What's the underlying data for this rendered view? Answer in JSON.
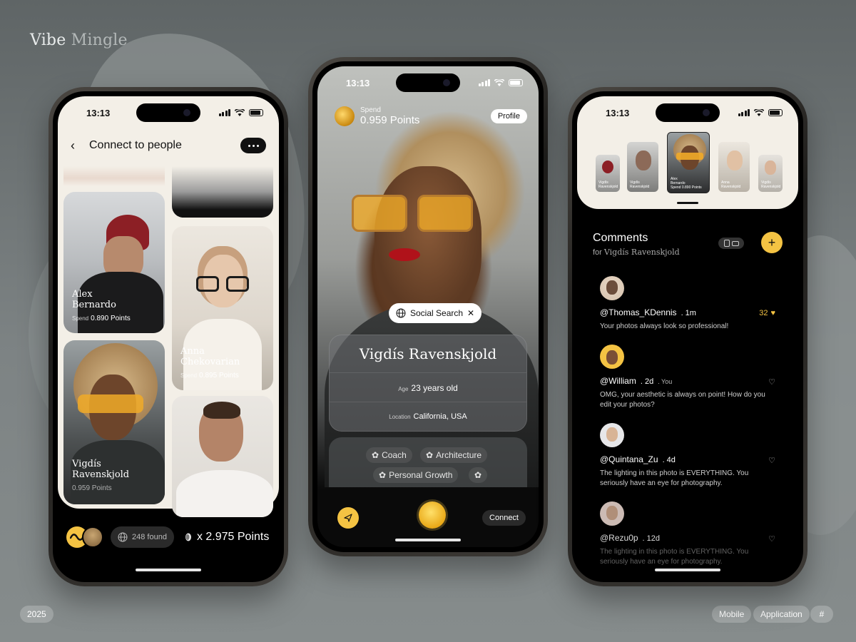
{
  "brand": {
    "word1": "Vibe",
    "word2": "Mingle"
  },
  "footer": {
    "year": "2025",
    "tags": [
      "Mobile",
      "Application",
      "#"
    ]
  },
  "status_time": "13:13",
  "phone1": {
    "title": "Connect to people",
    "cards": [
      {
        "name_line1": "Alex",
        "name_line2": "Bernardo",
        "spend_label": "Spend",
        "spend_value": "0.890 Points"
      },
      {
        "name_line1": "Anna",
        "name_line2": "Chekovarian",
        "spend_label": "Spend",
        "spend_value": "0.895 Points"
      },
      {
        "name_line1": "Vigdís",
        "name_line2": "Ravenskjold",
        "spend_label": "",
        "spend_value": "0.959 Points"
      }
    ],
    "found": "248 found",
    "total_points": "x 2.975 Points"
  },
  "phone2": {
    "spend_label": "Spend",
    "spend_value": "0.959 Points",
    "profile_button": "Profile",
    "social_search": "Social Search",
    "name": "Vigdís Ravenskjold",
    "age_label": "Age",
    "age_value": "23 years old",
    "location_label": "Location",
    "location_value": "California, USA",
    "tags": [
      "Coach",
      "Architecture",
      "Personal Growth"
    ],
    "connect_button": "Connect"
  },
  "phone3": {
    "thumbs": [
      {
        "line1": "Vigdís",
        "line2": "Ravenskjold"
      },
      {
        "line1": "Vigdís",
        "line2": "Ravenskjold"
      },
      {
        "line1": "Alex",
        "line2": "Bernardo",
        "line3": "Spend 0.890 Points"
      },
      {
        "line1": "Anna",
        "line2": "Ravenskjold"
      },
      {
        "line1": "Vigdís",
        "line2": "Ravenskjold"
      }
    ],
    "comments_title": "Comments",
    "for_label": "for",
    "for_name": "Vigdís Ravenskjold",
    "comments": [
      {
        "user": "@Thomas_KDennis",
        "time": ". 1m",
        "you": "",
        "likes": "32",
        "text": "Your photos always look so professional!"
      },
      {
        "user": "@William",
        "time": ". 2d",
        "you": ". You",
        "likes": "",
        "text": "OMG, your aesthetic is always on point! How do you edit your photos?"
      },
      {
        "user": "@Quintana_Zu",
        "time": ". 4d",
        "you": "",
        "likes": "",
        "text": "The lighting in this photo is EVERYTHING. You seriously have an eye for photography."
      },
      {
        "user": "@Rezu0p",
        "time": ". 12d",
        "you": "",
        "likes": "",
        "text": "The lighting in this photo is EVERYTHING. You seriously have an eye for photography."
      }
    ]
  },
  "colors": {
    "accent": "#f4c343",
    "cream": "#f3efe7",
    "background": "#6f7576"
  }
}
